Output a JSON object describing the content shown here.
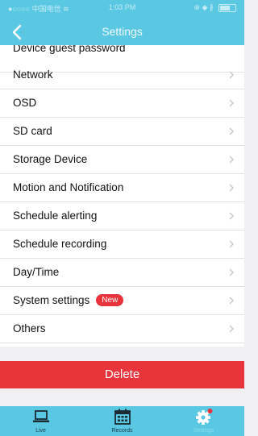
{
  "status_bar": {
    "carrier": "●○○○○ 中国电信 ≋",
    "time": "1:03 PM",
    "right": "⊕ ◆ ∦"
  },
  "header": {
    "title": "Settings"
  },
  "settings_items": [
    {
      "label": "Device guest password"
    },
    {
      "label": "Network"
    },
    {
      "label": "OSD"
    },
    {
      "label": "SD card"
    },
    {
      "label": "Storage Device"
    },
    {
      "label": "Motion and Notification"
    },
    {
      "label": "Schedule alerting"
    },
    {
      "label": "Schedule recording"
    },
    {
      "label": "Day/Time"
    },
    {
      "label": "System settings",
      "badge": "New"
    },
    {
      "label": "Others"
    }
  ],
  "delete_label": "Delete",
  "tabs": [
    {
      "label": "Live",
      "icon": "laptop-icon"
    },
    {
      "label": "Records",
      "icon": "calendar-icon"
    },
    {
      "label": "Settings",
      "icon": "gear-icon",
      "active": true
    }
  ],
  "colors": {
    "accent": "#5ac8e3",
    "delete": "#e8353b",
    "badge": "#e8333a",
    "notification_dot": "#e8333a"
  }
}
